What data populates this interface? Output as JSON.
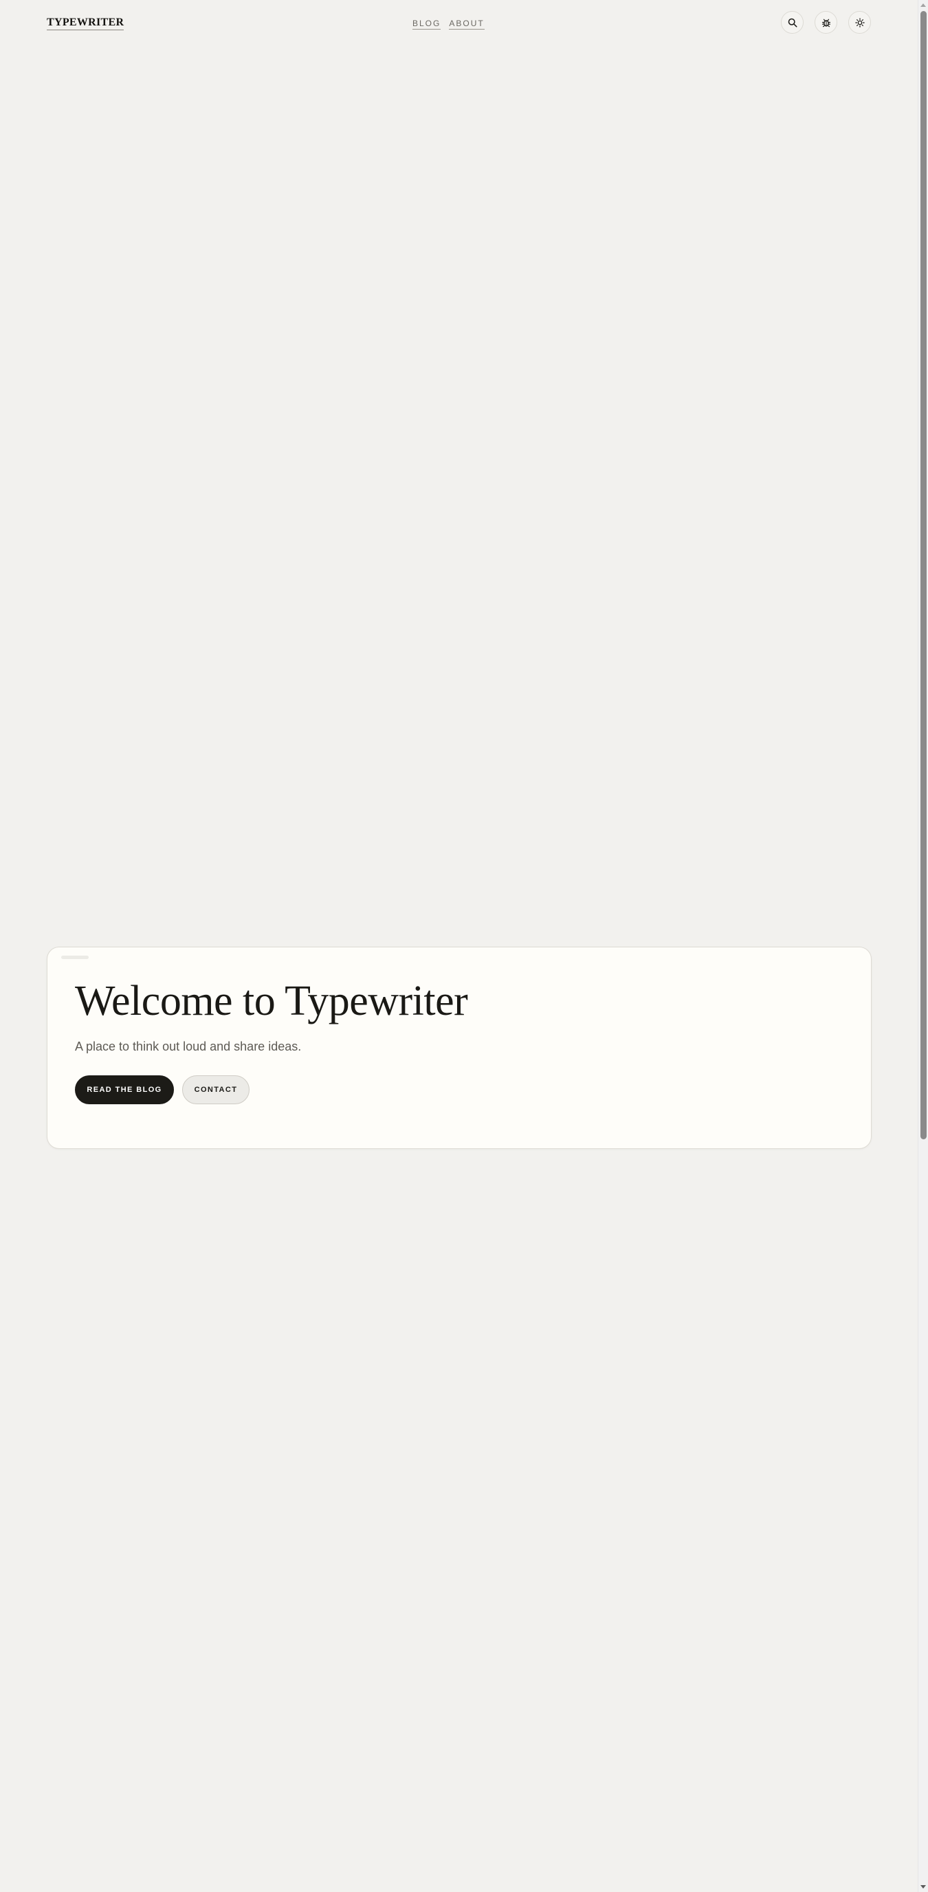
{
  "header": {
    "brand": "TYPEWRITER",
    "nav": [
      {
        "label": "BLOG"
      },
      {
        "label": "ABOUT"
      }
    ],
    "actions": [
      {
        "icon": "search-icon"
      },
      {
        "icon": "bug-icon"
      },
      {
        "icon": "sun-icon"
      }
    ]
  },
  "hero": {
    "title": "Welcome to Typewriter",
    "subtitle": "A place to think out loud and share ideas.",
    "primary_button": "READ THE BLOG",
    "secondary_button": "CONTACT"
  },
  "colors": {
    "page_background": "#f2f1ee",
    "card_background": "#fefdf9",
    "primary_button": "#1c1b17",
    "text": "#1c1b18"
  }
}
